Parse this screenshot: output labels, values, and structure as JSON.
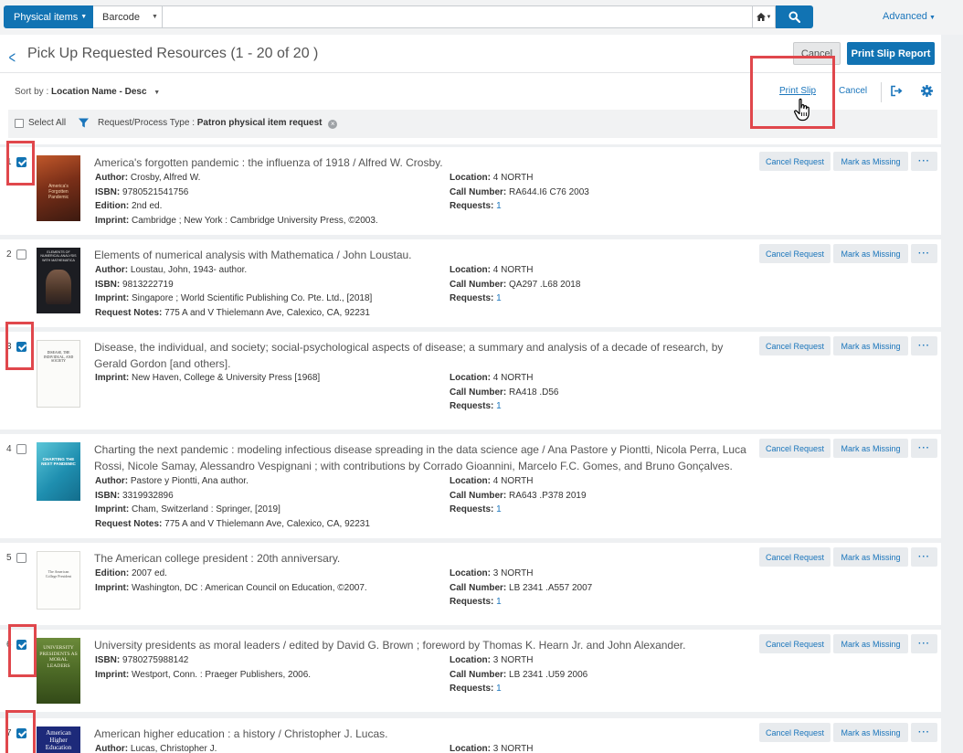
{
  "search": {
    "scope_label": "Physical items",
    "field_label": "Barcode",
    "query": "",
    "advanced_label": "Advanced"
  },
  "header": {
    "title": "Pick Up Requested Resources (1 - 20 of 20 )",
    "cancel_label": "Cancel",
    "print_report_label": "Print Slip Report"
  },
  "toolbar": {
    "sort_prefix": "Sort by :",
    "sort_value": "Location Name - Desc",
    "print_slip_label": "Print Slip",
    "cancel_label": "Cancel"
  },
  "filter": {
    "select_all_label": "Select All",
    "filter_prefix": "Request/Process Type :",
    "filter_value": "Patron physical item request"
  },
  "actions": {
    "cancel_request": "Cancel Request",
    "mark_missing": "Mark as Missing",
    "more": "···"
  },
  "labels": {
    "author": "Author:",
    "isbn": "ISBN:",
    "edition": "Edition:",
    "imprint": "Imprint:",
    "request_notes": "Request Notes:",
    "location": "Location:",
    "call_number": "Call Number:",
    "requests": "Requests:"
  },
  "items": [
    {
      "num": "1",
      "checked": true,
      "title": "America's forgotten pandemic : the influenza of 1918 / Alfred W. Crosby.",
      "author": "Crosby, Alfred W.",
      "isbn": "9780521541756",
      "edition": "2nd ed.",
      "imprint": "Cambridge ; New York : Cambridge University Press, ©2003.",
      "location": "4 NORTH",
      "call_number": "RA644.I6 C76 2003",
      "requests": "1"
    },
    {
      "num": "2",
      "checked": false,
      "title": "Elements of numerical analysis with Mathematica / John Loustau.",
      "author": "Loustau, John, 1943- author.",
      "isbn": "9813222719",
      "imprint": "Singapore ; World Scientific Publishing Co. Pte. Ltd., [2018]",
      "request_notes": "775 A and V Thielemann Ave, Calexico, CA, 92231",
      "location": "4 NORTH",
      "call_number": "QA297 .L68 2018",
      "requests": "1"
    },
    {
      "num": "3",
      "checked": true,
      "title": "Disease, the individual, and society; social-psychological aspects of disease; a summary and analysis of a decade of research, by Gerald Gordon [and others].",
      "imprint": "New Haven, College & University Press [1968]",
      "location": "4 NORTH",
      "call_number": "RA418 .D56",
      "requests": "1"
    },
    {
      "num": "4",
      "checked": false,
      "title": "Charting the next pandemic : modeling infectious disease spreading in the data science age / Ana Pastore y Piontti, Nicola Perra, Luca Rossi, Nicole Samay, Alessandro Vespignani ; with contributions by Corrado Gioannini, Marcelo F.C. Gomes, and Bruno Gonçalves.",
      "author": "Pastore y Piontti, Ana author.",
      "isbn": "3319932896",
      "imprint": "Cham, Switzerland : Springer, [2019]",
      "request_notes": "775 A and V Thielemann Ave, Calexico, CA, 92231",
      "location": "4 NORTH",
      "call_number": "RA643 .P378 2019",
      "requests": "1"
    },
    {
      "num": "5",
      "checked": false,
      "title": "The American college president : 20th anniversary.",
      "edition": "2007 ed.",
      "imprint": "Washington, DC : American Council on Education, ©2007.",
      "location": "3 NORTH",
      "call_number": "LB 2341 .A557 2007",
      "requests": "1"
    },
    {
      "num": "6",
      "checked": true,
      "title": "University presidents as moral leaders / edited by David G. Brown ; foreword by Thomas K. Hearn Jr. and John Alexander.",
      "isbn": "9780275988142",
      "imprint": "Westport, Conn. : Praeger Publishers, 2006.",
      "location": "3 NORTH",
      "call_number": "LB 2341 .U59 2006",
      "requests": "1"
    },
    {
      "num": "7",
      "checked": true,
      "title": "American higher education : a history / Christopher J. Lucas.",
      "author": "Lucas, Christopher J.",
      "location": "3 NORTH"
    }
  ],
  "covers": {
    "c1": "America's Forgotten Pandemic",
    "c2": "ELEMENTS OF NUMERICAL ANALYSIS WITH MATHEMATICA",
    "c3": "DISEASE, THE INDIVIDUAL, AND SOCIETY",
    "c4": "CHARTING THE NEXT PANDEMIC",
    "c5": "The American College President",
    "c6": "UNIVERSITY PRESIDENTS AS MORAL LEADERS",
    "c7": "American Higher Education"
  },
  "colors": {
    "primary": "#1173b3",
    "link": "#1a75bb",
    "highlight": "#e0474c"
  }
}
